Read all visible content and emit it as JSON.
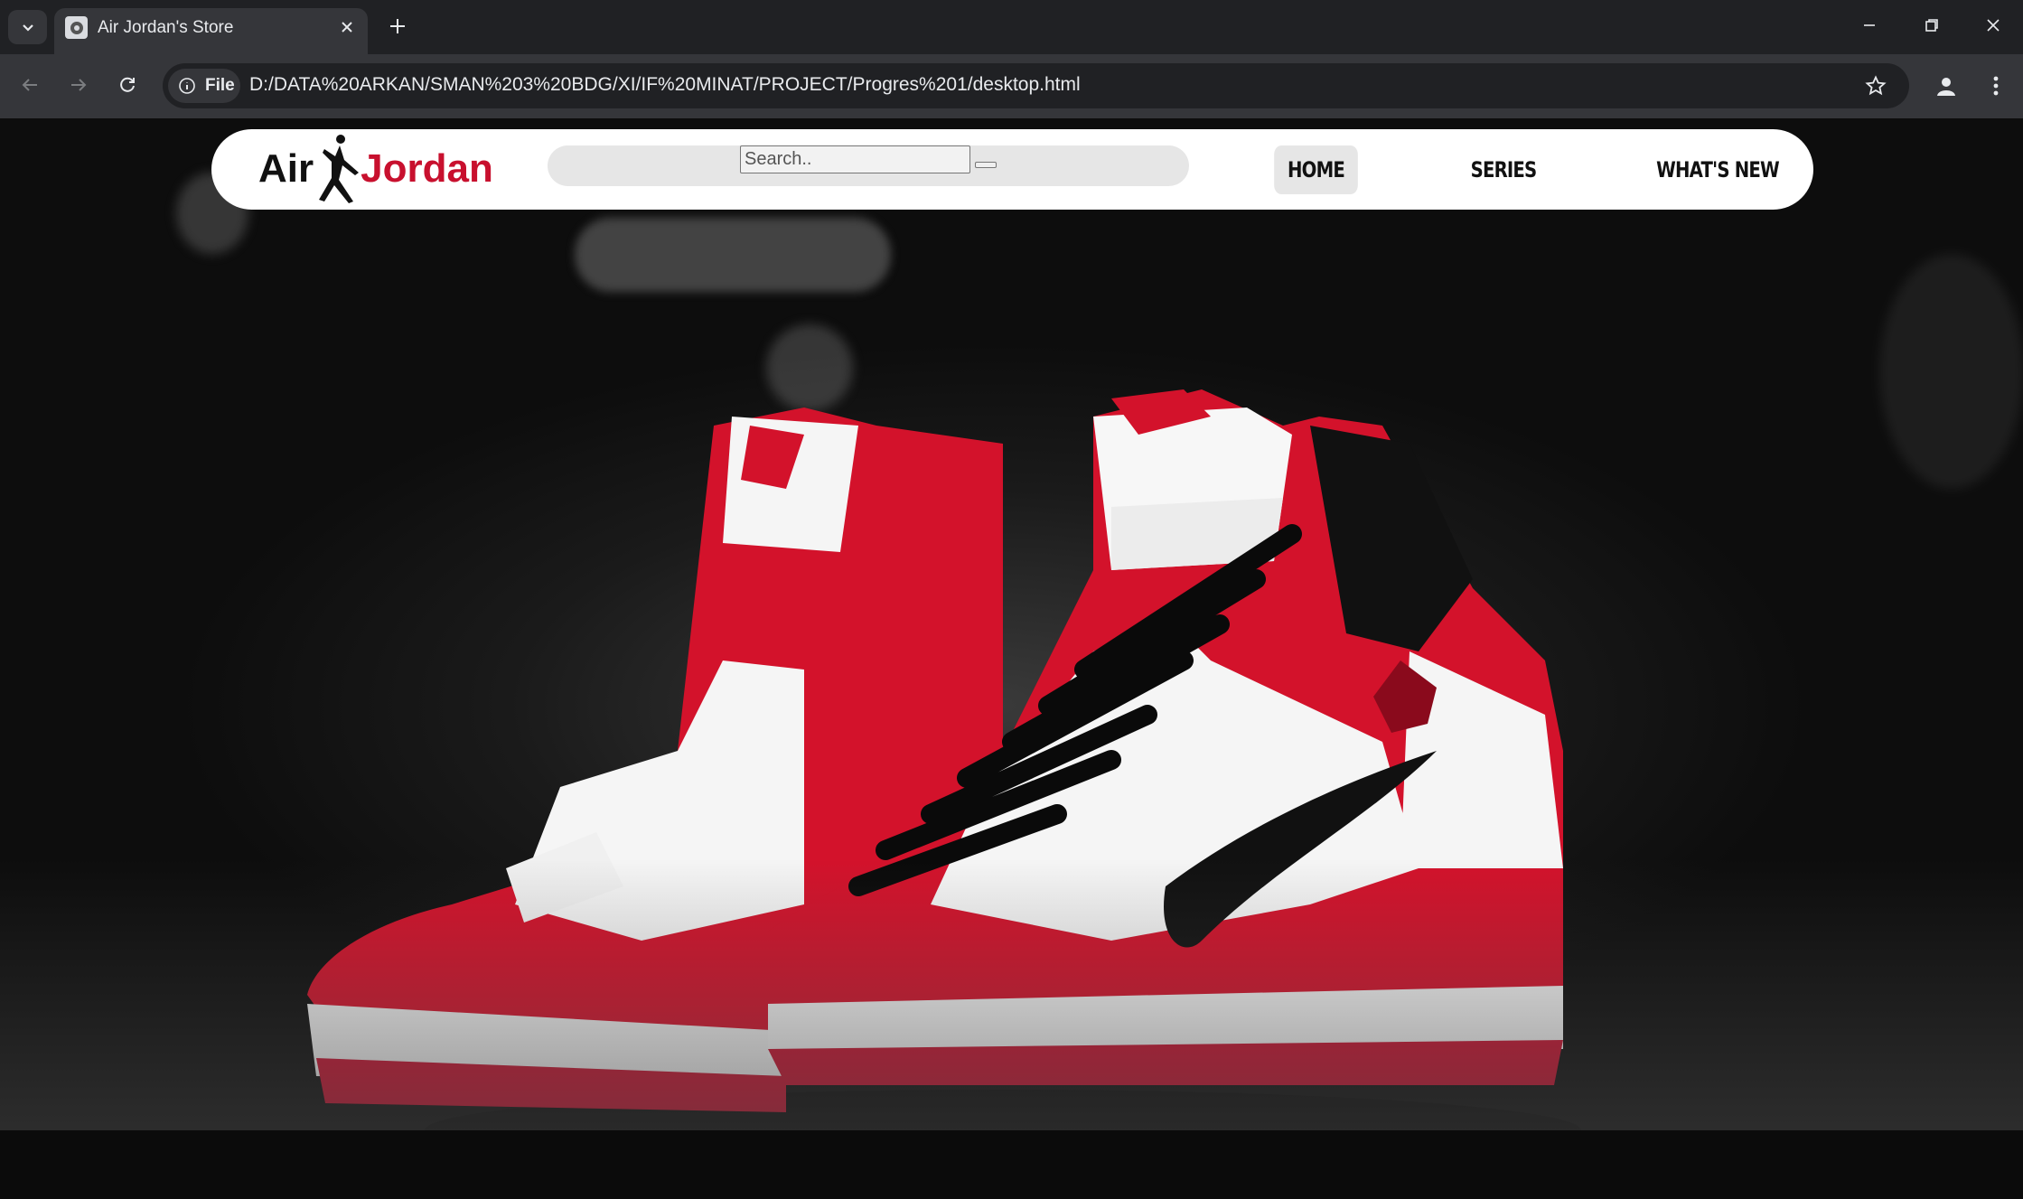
{
  "browser": {
    "tab_title": "Air Jordan's Store",
    "site_chip_label": "File",
    "url": "D:/DATA%20ARKAN/SMAN%203%20BDG/XI/IF%20MINAT/PROJECT/Progres%201/desktop.html"
  },
  "site": {
    "logo": {
      "part1": "Air",
      "part2": "Jordan"
    },
    "search": {
      "placeholder": "Search.."
    },
    "nav": [
      {
        "label": "Home",
        "active": true
      },
      {
        "label": "Series",
        "active": false
      },
      {
        "label": "What's New",
        "active": false
      }
    ]
  },
  "hero": {
    "image": "red-white-black-high-top-sneakers",
    "colors": {
      "red": "#d3122b",
      "white": "#f5f5f5",
      "black": "#111111"
    }
  }
}
